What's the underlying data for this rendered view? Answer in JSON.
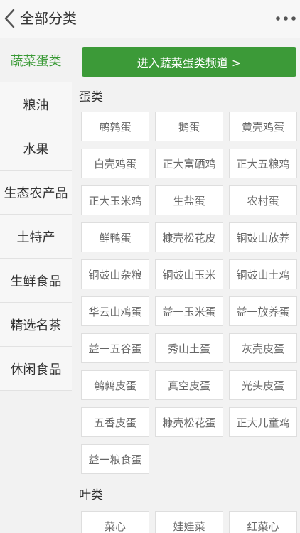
{
  "header": {
    "title": "全部分类"
  },
  "sidebar": {
    "items": [
      {
        "label": "蔬菜蛋类"
      },
      {
        "label": "粮油"
      },
      {
        "label": "水果"
      },
      {
        "label": "生态农产品"
      },
      {
        "label": "土特产"
      },
      {
        "label": "生鲜食品"
      },
      {
        "label": "精选名茶"
      },
      {
        "label": "休闲食品"
      }
    ]
  },
  "main": {
    "channel_button": "进入蔬菜蛋类频道 >",
    "sections": [
      {
        "title": "蛋类",
        "items": [
          "鹌鹑蛋",
          "鹅蛋",
          "黄壳鸡蛋",
          "白壳鸡蛋",
          "正大富硒鸡",
          "正大五粮鸡",
          "正大玉米鸡",
          "生盐蛋",
          "农村蛋",
          "鲜鸭蛋",
          "糠壳松花皮",
          "铜鼓山放养",
          "铜鼓山杂粮",
          "铜鼓山玉米",
          "铜鼓山土鸡",
          "华云山鸡蛋",
          "益一玉米蛋",
          "益一放养蛋",
          "益一五谷蛋",
          "秀山土蛋",
          "灰壳皮蛋",
          "鹌鹑皮蛋",
          "真空皮蛋",
          "光头皮蛋",
          "五香皮蛋",
          "糠壳松花蛋",
          "正大儿童鸡",
          "益一粮食蛋"
        ]
      },
      {
        "title": "叶类",
        "items": [
          "菜心",
          "娃娃菜",
          "红菜心"
        ]
      }
    ]
  },
  "colors": {
    "accent": "#3c9a38",
    "active_text": "#3a9a36"
  }
}
